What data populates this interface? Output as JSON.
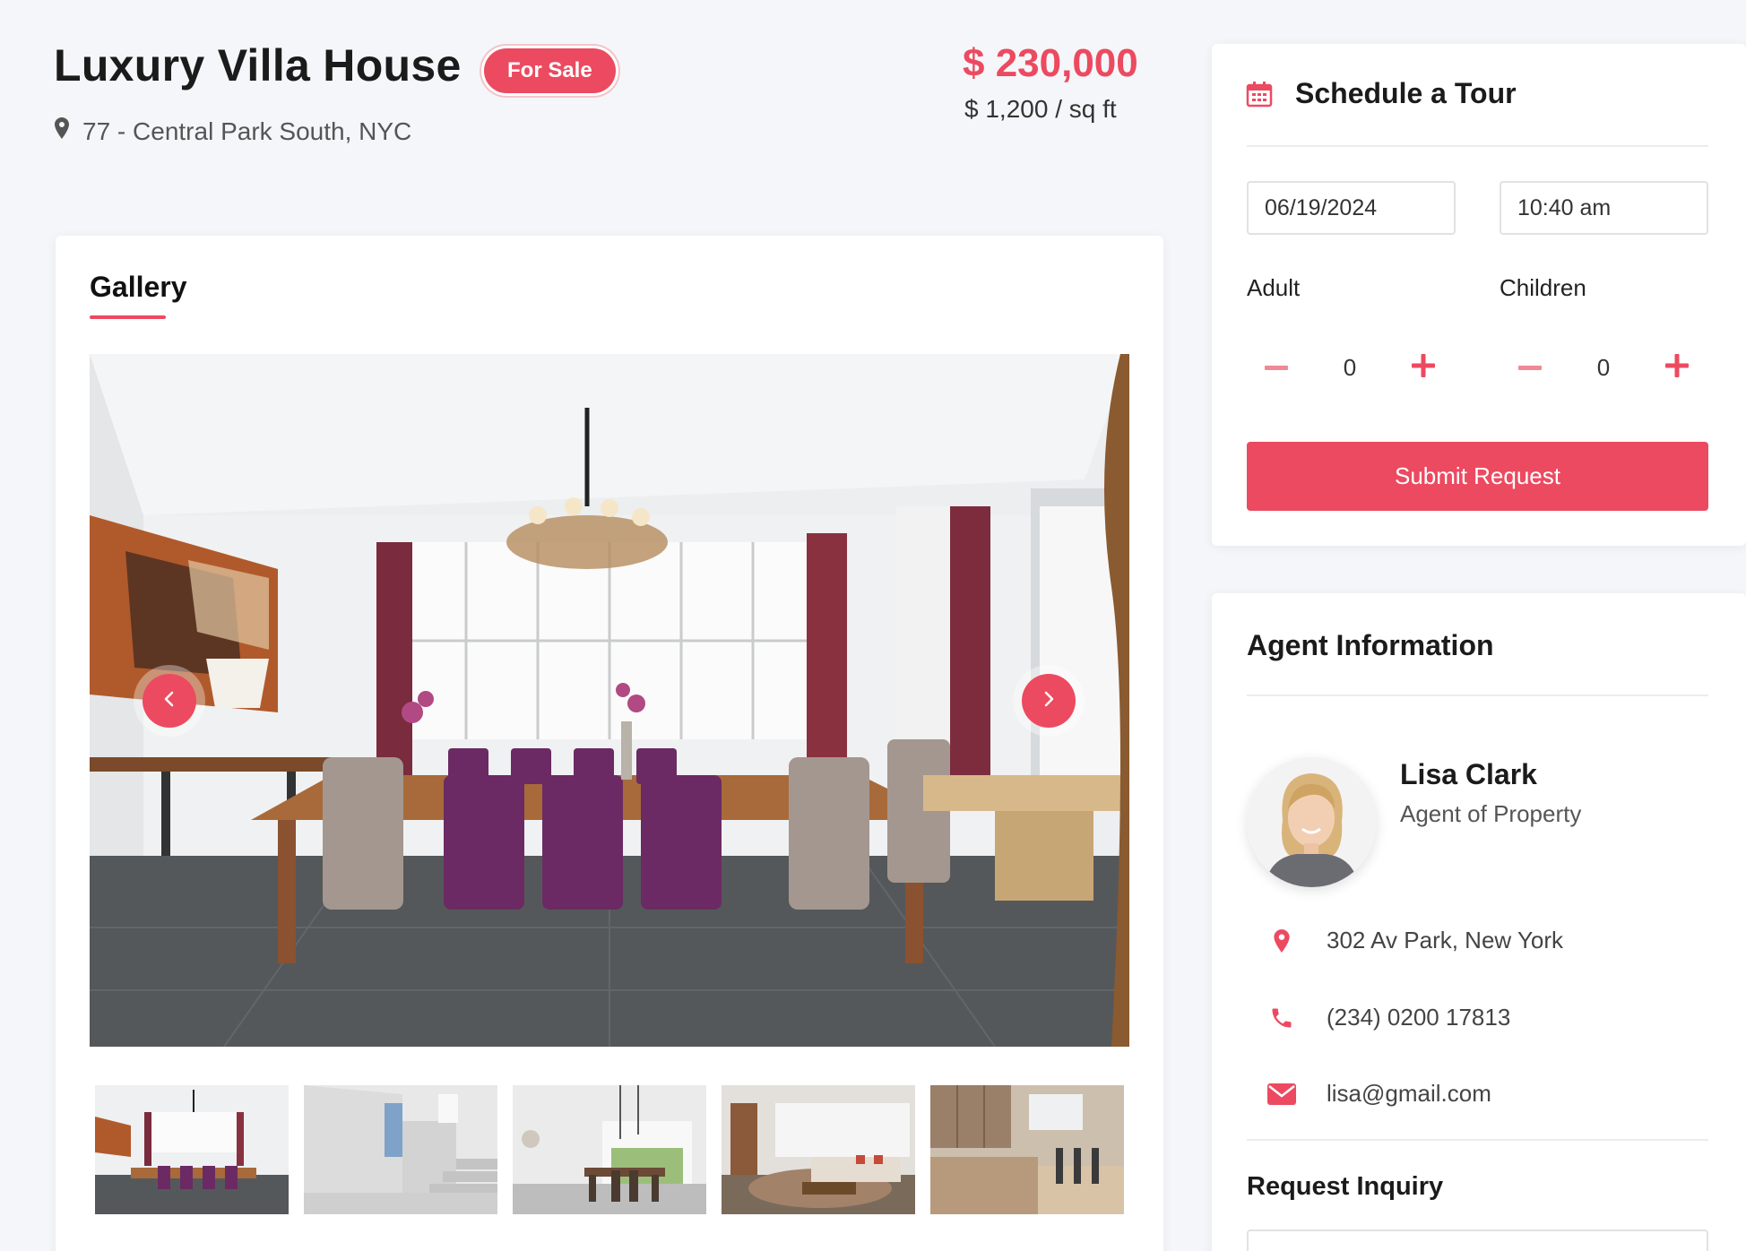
{
  "property": {
    "title": "Luxury Villa House",
    "status_badge": "For Sale",
    "address": "77 - Central Park South, NYC",
    "price": "$ 230,000",
    "price_per_sqft": "$ 1,200 / sq ft"
  },
  "gallery": {
    "title": "Gallery",
    "current_index": 0,
    "thumbnail_count": 5
  },
  "schedule": {
    "title": "Schedule a Tour",
    "date_value": "06/19/2024",
    "time_value": "10:40 am",
    "adult_label": "Adult",
    "adult_value": "0",
    "children_label": "Children",
    "children_value": "0",
    "submit_label": "Submit Request"
  },
  "agent": {
    "section_title": "Agent Information",
    "name": "Lisa Clark",
    "role": "Agent of Property",
    "address": "302 Av Park, New York",
    "phone": "(234) 0200 17813",
    "email": "lisa@gmail.com"
  },
  "inquiry": {
    "title": "Request Inquiry"
  },
  "colors": {
    "accent": "#ec4a60",
    "background": "#f5f6f9",
    "card": "#ffffff"
  }
}
